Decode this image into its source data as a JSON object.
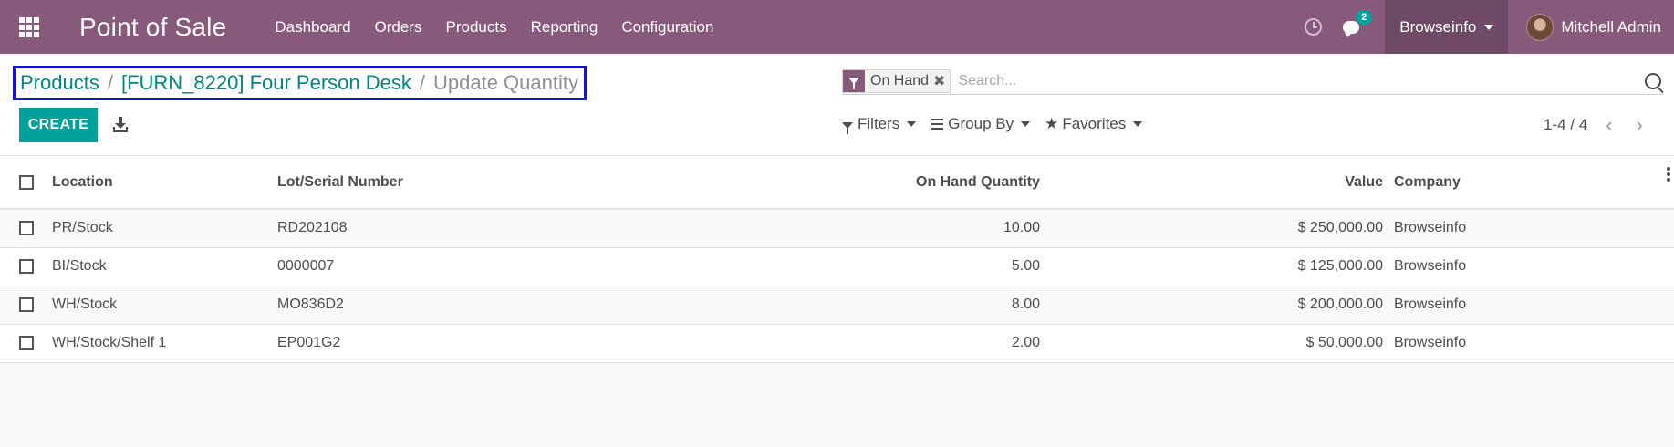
{
  "navbar": {
    "app_title": "Point of Sale",
    "menu": [
      "Dashboard",
      "Orders",
      "Products",
      "Reporting",
      "Configuration"
    ],
    "messages_count": "2",
    "company": "Browseinfo",
    "user": "Mitchell Admin",
    "color": "#875a7b"
  },
  "breadcrumb": {
    "items": [
      "Products",
      "[FURN_8220] Four Person Desk"
    ],
    "active": "Update Quantity",
    "separator": "/"
  },
  "toolbar": {
    "create_label": "CREATE",
    "download_icon": "download-icon"
  },
  "search": {
    "facet_label": "On Hand",
    "placeholder": "Search..."
  },
  "filters": {
    "filters_label": "Filters",
    "group_by_label": "Group By",
    "favorites_label": "Favorites"
  },
  "pager": {
    "range": "1-4 / 4"
  },
  "table": {
    "headers": {
      "location": "Location",
      "lot": "Lot/Serial Number",
      "on_hand": "On Hand Quantity",
      "value": "Value",
      "company": "Company"
    },
    "rows": [
      {
        "location": "PR/Stock",
        "lot": "RD202108",
        "on_hand": "10.00",
        "value": "$ 250,000.00",
        "company": "Browseinfo"
      },
      {
        "location": "BI/Stock",
        "lot": "0000007",
        "on_hand": "5.00",
        "value": "$ 125,000.00",
        "company": "Browseinfo"
      },
      {
        "location": "WH/Stock",
        "lot": "MO836D2",
        "on_hand": "8.00",
        "value": "$ 200,000.00",
        "company": "Browseinfo"
      },
      {
        "location": "WH/Stock/Shelf 1",
        "lot": "EP001G2",
        "on_hand": "2.00",
        "value": "$ 50,000.00",
        "company": "Browseinfo"
      }
    ]
  }
}
